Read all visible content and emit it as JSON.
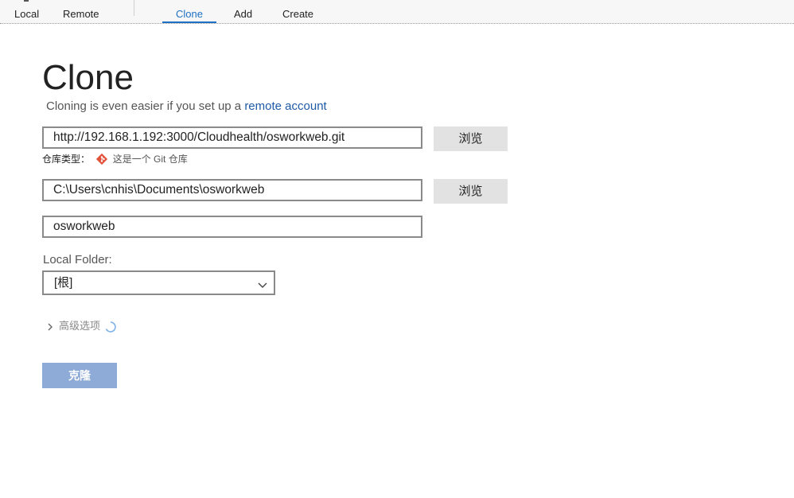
{
  "topbar": {
    "tabs_left": [
      {
        "label": "Local"
      },
      {
        "label": "Remote"
      }
    ],
    "tabs_right": [
      {
        "label": "Clone",
        "active": true
      },
      {
        "label": "Add"
      },
      {
        "label": "Create"
      }
    ],
    "active_color": "#1f6fc4"
  },
  "clone": {
    "title": "Clone",
    "subtitle_prefix": "Cloning is even easier if you set up a ",
    "subtitle_link": "remote account",
    "source_url": "http://192.168.1.192:3000/Cloudhealth/osworkweb.git",
    "browse_label_1": "浏览",
    "repo_type_label": "仓库类型：",
    "repo_type_value": "这是一个 Git 仓库",
    "destination_path": "C:\\Users\\cnhis\\Documents\\osworkweb",
    "browse_label_2": "浏览",
    "name": "osworkweb",
    "local_folder_label": "Local Folder:",
    "local_folder_value": "[根]",
    "advanced_label": "高级选项",
    "clone_button_label": "克隆",
    "clone_button_color": "#8eaad6",
    "git_icon_color": "#e2513a",
    "link_color": "#1f5aa6"
  }
}
